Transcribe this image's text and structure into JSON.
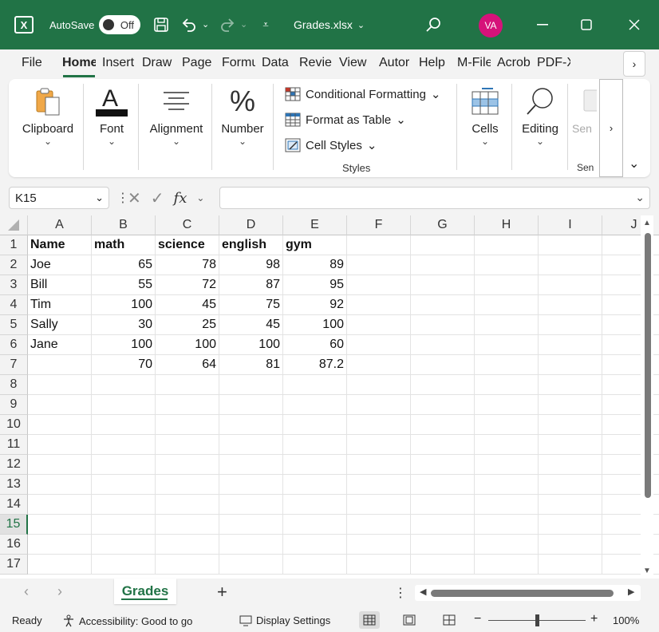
{
  "titlebar": {
    "app_icon": "excel-icon",
    "autosave_label": "AutoSave",
    "autosave_state": "Off",
    "filename": "Grades.xlsx",
    "avatar_initials": "VA",
    "accent": "#217346",
    "avatar_color": "#d6127a"
  },
  "tabs": [
    "File",
    "Home",
    "Insert",
    "Draw",
    "Page",
    "Formu",
    "Data",
    "Revie",
    "View",
    "Autor",
    "Help",
    "M-File",
    "Acrob",
    "PDF-X"
  ],
  "ribbon": {
    "clipboard": "Clipboard",
    "font": "Font",
    "alignment": "Alignment",
    "number": "Number",
    "conditional_formatting": "Conditional Formatting",
    "format_as_table": "Format as Table",
    "cell_styles": "Cell Styles",
    "styles_group": "Styles",
    "cells": "Cells",
    "editing": "Editing",
    "sensitivity_short": "Sen",
    "sensitivity_short2": "Sen"
  },
  "formula": {
    "namebox": "K15",
    "fx": "fx",
    "value": ""
  },
  "columns": [
    "A",
    "B",
    "C",
    "D",
    "E",
    "F",
    "G",
    "H",
    "I",
    "J"
  ],
  "rows": [
    "1",
    "2",
    "3",
    "4",
    "5",
    "6",
    "7",
    "8",
    "9",
    "10",
    "11",
    "12",
    "13",
    "14",
    "15",
    "16",
    "17"
  ],
  "selected_row": "15",
  "cells": {
    "header": [
      "Name",
      "math",
      "science",
      "english",
      "gym"
    ],
    "data": [
      [
        "Joe",
        "65",
        "78",
        "98",
        "89"
      ],
      [
        "Bill",
        "55",
        "72",
        "87",
        "95"
      ],
      [
        "Tim",
        "100",
        "45",
        "75",
        "92"
      ],
      [
        "Sally",
        "30",
        "25",
        "45",
        "100"
      ],
      [
        "Jane",
        "100",
        "100",
        "100",
        "60"
      ],
      [
        "",
        "70",
        "64",
        "81",
        "87.2"
      ]
    ]
  },
  "sheets": {
    "active": "Grades"
  },
  "status": {
    "ready": "Ready",
    "accessibility": "Accessibility: Good to go",
    "display_settings": "Display Settings",
    "zoom": "100%"
  }
}
